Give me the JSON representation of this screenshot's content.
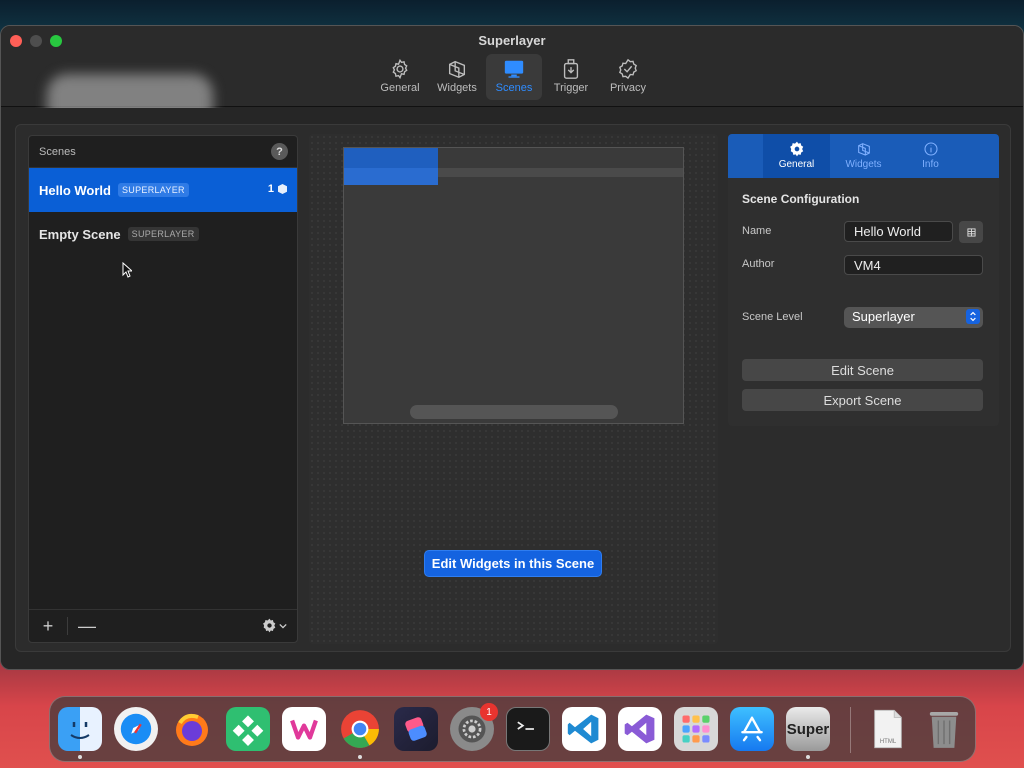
{
  "window": {
    "title": "Superlayer"
  },
  "toolbar": {
    "items": [
      {
        "label": "General",
        "icon": "gear-icon"
      },
      {
        "label": "Widgets",
        "icon": "widgets-icon"
      },
      {
        "label": "Scenes",
        "icon": "display-icon",
        "active": true
      },
      {
        "label": "Trigger",
        "icon": "trigger-icon"
      },
      {
        "label": "Privacy",
        "icon": "privacy-check-icon"
      }
    ]
  },
  "scenes_panel": {
    "header": "Scenes",
    "help_label": "?",
    "items": [
      {
        "name": "Hello World",
        "badge": "SUPERLAYER",
        "count": "1",
        "selected": true
      },
      {
        "name": "Empty Scene",
        "badge": "SUPERLAYER"
      }
    ],
    "add_label": "+",
    "remove_label": "—"
  },
  "preview": {
    "edit_widgets_label": "Edit Widgets in this Scene"
  },
  "config": {
    "tabs": [
      {
        "label": "General",
        "icon": "gear-icon",
        "active": true
      },
      {
        "label": "Widgets",
        "icon": "widgets-icon"
      },
      {
        "label": "Info",
        "icon": "info-icon"
      }
    ],
    "title": "Scene Configuration",
    "name_label": "Name",
    "name_value": "Hello World",
    "author_label": "Author",
    "author_value": "VM4",
    "level_label": "Scene Level",
    "level_value": "Superlayer",
    "edit_scene_label": "Edit Scene",
    "export_scene_label": "Export Scene"
  },
  "dock": {
    "apps": [
      "Finder",
      "Safari",
      "Firefox",
      "Xcodes",
      "Writer",
      "Chrome",
      "Shortcuts",
      "System Settings",
      "Terminal",
      "VS Code",
      "Visual Studio",
      "Launchpad",
      "App Store",
      "Super",
      "HTML file",
      "Trash"
    ],
    "super_label": "Super",
    "settings_badge": "1",
    "html_file_label": "HTML"
  },
  "colors": {
    "accent": "#0a5fd6",
    "button_blue": "#1463e0",
    "badge_red": "#e8342f"
  }
}
